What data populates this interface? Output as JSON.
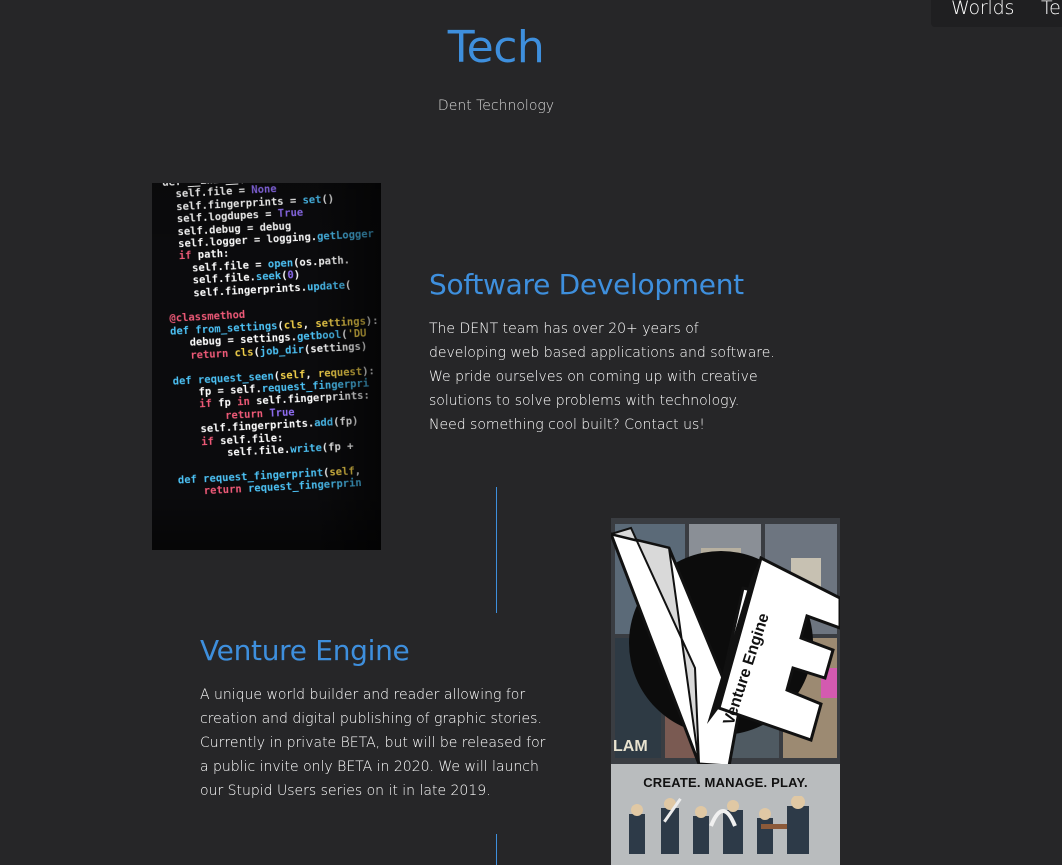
{
  "nav": {
    "items": [
      {
        "label": "Worlds"
      },
      {
        "label": "Te"
      }
    ]
  },
  "header": {
    "title": "Tech",
    "subtitle": "Dent Technology"
  },
  "sections": [
    {
      "title": "Software Development",
      "text": "The DENT team has over 20+ years of developing web based applications and software. We pride ourselves on coming up with creative solutions to solve problems with technology. Need something cool built? Contact us!",
      "image": "code-screenshot"
    },
    {
      "title": "Venture Engine",
      "text": "A unique world builder and reader allowing for creation and digital publishing of graphic stories. Currently in private BETA, but will be released for a public invite only BETA in 2020. We will launch our Stupid Users series on it in late 2019.",
      "image": {
        "logo_letters": "VE",
        "logo_text": "Venture Engine",
        "tagline": "CREATE. MANAGE. PLAY.",
        "comic_label": "LAM"
      }
    }
  ],
  "colors": {
    "background": "#262628",
    "accent": "#3e8fdd",
    "text": "#ffffff"
  }
}
